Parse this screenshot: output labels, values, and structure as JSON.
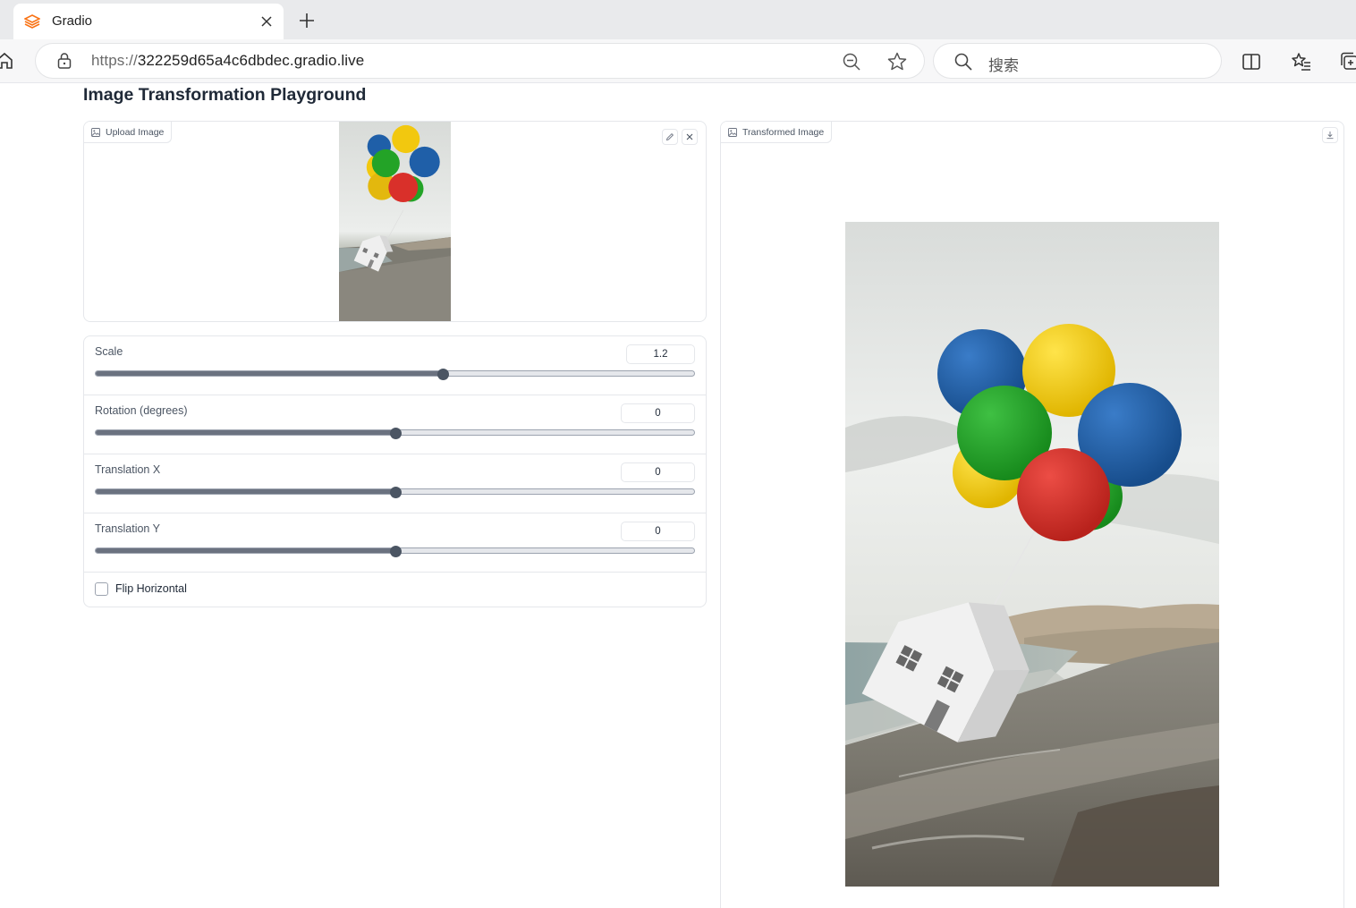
{
  "browser": {
    "tab_title": "Gradio",
    "url_protocol": "https://",
    "url_host": "322259d65a4c6dbdec.gradio.live",
    "search_placeholder": "搜索"
  },
  "page": {
    "title": "Image Transformation Playground",
    "upload": {
      "label": "Upload Image"
    },
    "output": {
      "label": "Transformed Image"
    },
    "sliders": [
      {
        "label": "Scale",
        "value": "1.2",
        "fraction": 0.58
      },
      {
        "label": "Rotation (degrees)",
        "value": "0",
        "fraction": 0.5
      },
      {
        "label": "Translation X",
        "value": "0",
        "fraction": 0.5
      },
      {
        "label": "Translation Y",
        "value": "0",
        "fraction": 0.5
      }
    ],
    "flip_horizontal": {
      "label": "Flip Horizontal",
      "checked": false
    }
  },
  "colors": {
    "gradio_orange": "#f97316",
    "balloon_blue": "#1f5fa8",
    "balloon_yellow": "#f2c80f",
    "balloon_green": "#23a327",
    "balloon_red": "#d9302a"
  }
}
